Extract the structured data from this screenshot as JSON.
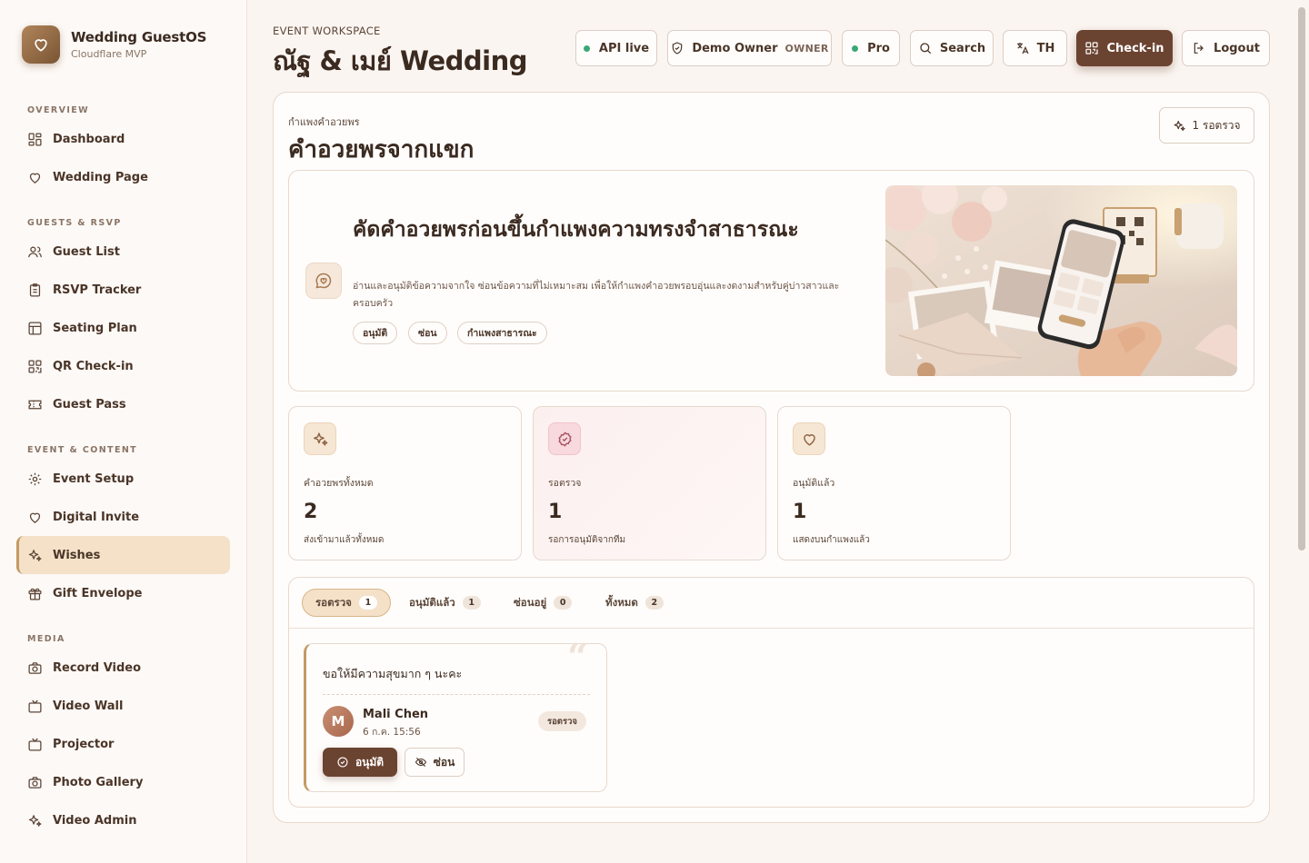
{
  "brand": {
    "title": "Wedding GuestOS",
    "subtitle": "Cloudflare MVP"
  },
  "sidebar": {
    "sections": [
      {
        "label": "OVERVIEW"
      },
      {
        "label": "GUESTS & RSVP"
      },
      {
        "label": "EVENT & CONTENT"
      },
      {
        "label": "MEDIA"
      }
    ],
    "items": [
      {
        "label": "Dashboard",
        "icon": "grid-icon"
      },
      {
        "label": "Wedding Page",
        "icon": "heart-icon"
      },
      {
        "label": "Guest List",
        "icon": "users-icon"
      },
      {
        "label": "RSVP Tracker",
        "icon": "clipboard-icon"
      },
      {
        "label": "Seating Plan",
        "icon": "layout-icon"
      },
      {
        "label": "QR Check-in",
        "icon": "qr-icon"
      },
      {
        "label": "Guest Pass",
        "icon": "ticket-icon"
      },
      {
        "label": "Event Setup",
        "icon": "gear-icon"
      },
      {
        "label": "Digital Invite",
        "icon": "heart-icon"
      },
      {
        "label": "Wishes",
        "icon": "sparkles-icon",
        "active": true
      },
      {
        "label": "Gift Envelope",
        "icon": "gift-icon"
      },
      {
        "label": "Record Video",
        "icon": "camera-icon"
      },
      {
        "label": "Video Wall",
        "icon": "tv-icon"
      },
      {
        "label": "Projector",
        "icon": "tv-icon"
      },
      {
        "label": "Photo Gallery",
        "icon": "camera-icon"
      },
      {
        "label": "Video Admin",
        "icon": "sparkles-icon"
      }
    ]
  },
  "header": {
    "workspace_label": "EVENT WORKSPACE",
    "event_title": "ณัฐ & เมย์ Wedding",
    "api_status": "API live",
    "owner_name": "Demo Owner",
    "owner_role": "OWNER",
    "plan": "Pro",
    "search_label": "Search",
    "language": "TH",
    "checkin_label": "Check-in",
    "logout_label": "Logout",
    "status_color": "#3aa876",
    "accent_color": "#6b4331"
  },
  "wall": {
    "label": "กำแพงคำอวยพร",
    "title": "คำอวยพรจากแขก",
    "pending_button": "1 รอตรวจ"
  },
  "hero": {
    "title": "คัดคำอวยพรก่อนขึ้นกำแพงความทรงจำสาธารณะ",
    "description": "อ่านและอนุมัติข้อความจากใจ ซ่อนข้อความที่ไม่เหมาะสม เพื่อให้กำแพงคำอวยพรอบอุ่นและงดงามสำหรับคู่บ่าวสาวและครอบครัว",
    "chips": [
      "อนุมัติ",
      "ซ่อน",
      "กำแพงสาธารณะ"
    ]
  },
  "stats": [
    {
      "label": "คำอวยพรทั้งหมด",
      "value": "2",
      "sub": "ส่งเข้ามาแล้วทั้งหมด",
      "icon": "sparkles-icon"
    },
    {
      "label": "รอตรวจ",
      "value": "1",
      "sub": "รอการอนุมัติจากทีม",
      "icon": "badge-check-icon"
    },
    {
      "label": "อนุมัติแล้ว",
      "value": "1",
      "sub": "แสดงบนกำแพงแล้ว",
      "icon": "heart-icon"
    }
  ],
  "tabs": [
    {
      "label": "รอตรวจ",
      "count": "1",
      "active": true
    },
    {
      "label": "อนุมัติแล้ว",
      "count": "1"
    },
    {
      "label": "ซ่อนอยู่",
      "count": "0"
    },
    {
      "label": "ทั้งหมด",
      "count": "2"
    }
  ],
  "wish": {
    "text": "ขอให้มีความสุขมาก ๆ นะคะ",
    "avatar_initial": "M",
    "author": "Mali Chen",
    "date": "6 ก.ค. 15:56",
    "status": "รอตรวจ",
    "approve_label": "อนุมัติ",
    "hide_label": "ซ่อน"
  }
}
